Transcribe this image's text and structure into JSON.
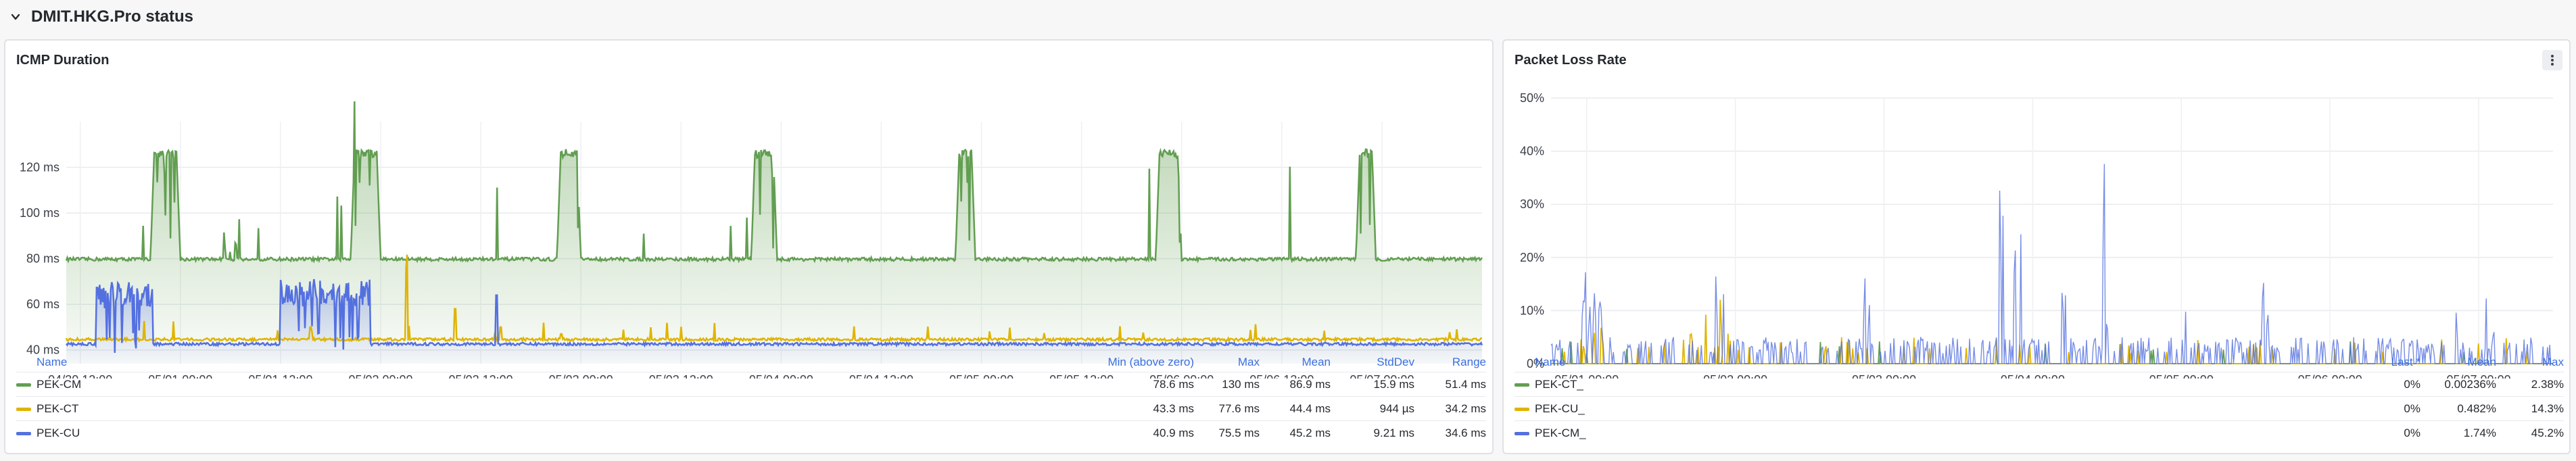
{
  "row": {
    "title": "DMIT.HKG.Pro status"
  },
  "colors": {
    "cm": "#629e51",
    "ct": "#e0b400",
    "cu": "#5470e0",
    "link": "#3b6fe0"
  },
  "icmp_panel": {
    "title": "ICMP Duration",
    "legend": {
      "headers": [
        "Name",
        "Min (above zero)",
        "Max",
        "Mean",
        "StdDev",
        "Range"
      ],
      "rows": [
        {
          "name": "PEK-CM",
          "color": "#629e51",
          "cells": [
            "78.6 ms",
            "130 ms",
            "86.9 ms",
            "15.9 ms",
            "51.4 ms"
          ]
        },
        {
          "name": "PEK-CT",
          "color": "#e0b400",
          "cells": [
            "43.3 ms",
            "77.6 ms",
            "44.4 ms",
            "944 µs",
            "34.2 ms"
          ]
        },
        {
          "name": "PEK-CU",
          "color": "#5470e0",
          "cells": [
            "40.9 ms",
            "75.5 ms",
            "45.2 ms",
            "9.21 ms",
            "34.6 ms"
          ]
        }
      ]
    }
  },
  "loss_panel": {
    "title": "Packet Loss Rate",
    "menu_icon": "kebab-menu-icon",
    "legend": {
      "headers": [
        "Name",
        "Last *",
        "Mean",
        "Max"
      ],
      "rows": [
        {
          "name": "PEK-CT_",
          "color": "#629e51",
          "cells": [
            "0%",
            "0.00236%",
            "2.38%"
          ]
        },
        {
          "name": "PEK-CU_",
          "color": "#e0b400",
          "cells": [
            "0%",
            "0.482%",
            "14.3%"
          ]
        },
        {
          "name": "PEK-CM_",
          "color": "#5470e0",
          "cells": [
            "0%",
            "1.74%",
            "45.2%"
          ]
        }
      ]
    }
  },
  "chart_data": [
    {
      "type": "area",
      "title": "ICMP Duration",
      "x_unit": "days since 04/30 00:00",
      "xlim": [
        0.43,
        7.5
      ],
      "ylim": [
        34,
        140
      ],
      "y_ticks": [
        40,
        60,
        80,
        100,
        120
      ],
      "y_tick_labels": [
        "40 ms",
        "60 ms",
        "80 ms",
        "100 ms",
        "120 ms"
      ],
      "x_ticks": [
        0.5,
        1.0,
        1.5,
        2.0,
        2.5,
        3.0,
        3.5,
        4.0,
        4.5,
        5.0,
        5.5,
        6.0,
        6.5,
        7.0
      ],
      "x_tick_labels": [
        "04/30 12:00",
        "05/01 00:00",
        "05/01 12:00",
        "05/02 00:00",
        "05/02 12:00",
        "05/03 00:00",
        "05/03 12:00",
        "05/04 00:00",
        "05/04 12:00",
        "05/05 00:00",
        "05/05 12:00",
        "05/06 00:00",
        "05/06 12:00",
        "05/07 00:00"
      ],
      "grid": true,
      "series": [
        {
          "name": "PEK-CM",
          "color": "#629e51",
          "baseline": 79,
          "peak": 128,
          "peaks": [
            [
              0.85,
              1.0
            ],
            [
              1.85,
              2.0
            ],
            [
              2.88,
              3.0
            ],
            [
              3.85,
              3.98
            ],
            [
              4.87,
              4.97
            ],
            [
              5.87,
              6.0
            ],
            [
              6.87,
              6.97
            ]
          ],
          "dip_blocks": [
            [
              1.2,
              1.3
            ]
          ]
        },
        {
          "name": "PEK-CT",
          "color": "#e0b400",
          "baseline": 44,
          "spikes": [
            [
              1.65,
              50
            ],
            [
              2.13,
              76
            ],
            [
              2.37,
              58
            ],
            [
              2.6,
              50
            ],
            [
              2.9,
              47
            ]
          ]
        },
        {
          "name": "PEK-CU",
          "color": "#5470e0",
          "baseline": 42,
          "elevated": [
            [
              0.58,
              0.86,
              70
            ],
            [
              1.5,
              1.95,
              71
            ]
          ],
          "spikes": [
            [
              0.42,
              60
            ],
            [
              2.58,
              64
            ]
          ]
        }
      ]
    },
    {
      "type": "line",
      "title": "Packet Loss Rate",
      "x_unit": "days since 04/30 00:00",
      "xlim": [
        0.76,
        7.5
      ],
      "ylim": [
        0,
        50
      ],
      "y_ticks": [
        0,
        10,
        20,
        30,
        40,
        50
      ],
      "y_tick_labels": [
        "0%",
        "10%",
        "20%",
        "30%",
        "40%",
        "50%"
      ],
      "x_ticks": [
        1,
        2,
        3,
        4,
        5,
        6,
        7
      ],
      "x_tick_labels": [
        "05/01 00:00",
        "05/02 00:00",
        "05/03 00:00",
        "05/04 00:00",
        "05/05 00:00",
        "05/06 00:00",
        "05/07 00:00"
      ],
      "grid": true,
      "series": [
        {
          "name": "PEK-CT_",
          "color": "#629e51",
          "spikes": [
            [
              6.9,
              2.4
            ],
            [
              1.0,
              2
            ]
          ]
        },
        {
          "name": "PEK-CU_",
          "color": "#e0b400",
          "spikes": [
            [
              1.05,
              7
            ],
            [
              1.7,
              8
            ],
            [
              1.8,
              10
            ],
            [
              1.9,
              14
            ],
            [
              1.95,
              6
            ],
            [
              1.1,
              9
            ],
            [
              1.65,
              5
            ]
          ]
        },
        {
          "name": "PEK-CM_",
          "color": "#5470e0",
          "spikes": [
            [
              0.99,
              21
            ],
            [
              1.02,
              13
            ],
            [
              1.05,
              16
            ],
            [
              1.87,
              19
            ],
            [
              1.92,
              14
            ],
            [
              2.87,
              19
            ],
            [
              2.9,
              13
            ],
            [
              3.78,
              39
            ],
            [
              3.8,
              29
            ],
            [
              3.88,
              28
            ],
            [
              3.92,
              25
            ],
            [
              4.2,
              17
            ],
            [
              4.22,
              13
            ],
            [
              4.48,
              45
            ],
            [
              4.5,
              10
            ],
            [
              5.03,
              11
            ],
            [
              5.55,
              20
            ],
            [
              5.58,
              12
            ],
            [
              6.05,
              6
            ],
            [
              6.85,
              11
            ],
            [
              7.05,
              13
            ],
            [
              7.1,
              8
            ]
          ]
        }
      ]
    }
  ]
}
